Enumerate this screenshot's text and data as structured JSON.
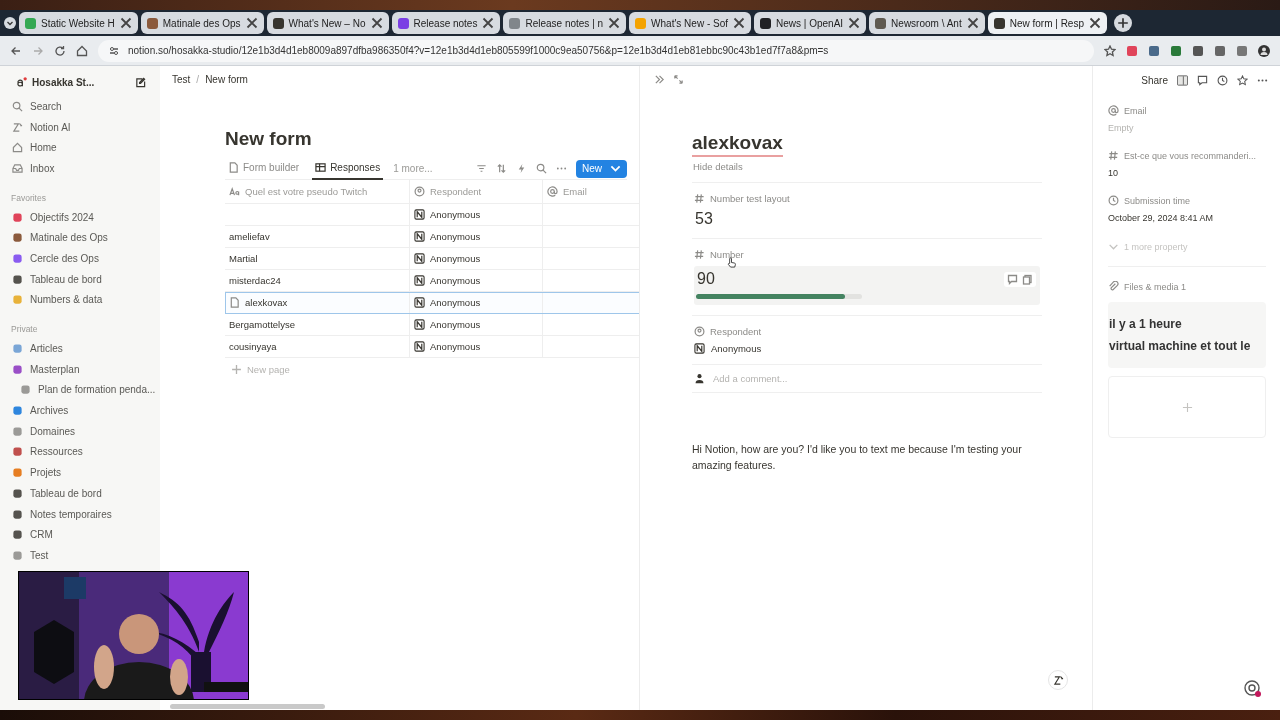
{
  "browser": {
    "tabs": [
      {
        "label": "Static Website H",
        "selected": false,
        "color": "#34a853"
      },
      {
        "label": "Matinale des Ops",
        "selected": false,
        "color": "#8b5a3c"
      },
      {
        "label": "What's New – No",
        "selected": false,
        "color": "#37352f"
      },
      {
        "label": "Release notes",
        "selected": false,
        "color": "#7b3fe4"
      },
      {
        "label": "Release notes | n",
        "selected": false,
        "color": "#80868b"
      },
      {
        "label": "What's New - Sof",
        "selected": false,
        "color": "#f4a300"
      },
      {
        "label": "News | OpenAI",
        "selected": false,
        "color": "#202124"
      },
      {
        "label": "Newsroom \\ Ant",
        "selected": false,
        "color": "#5f5a50"
      },
      {
        "label": "New form | Resp",
        "selected": true,
        "color": "#37352f"
      }
    ],
    "url": "notion.so/hosakka-studio/12e1b3d4d1eb8009a897dfba986350f4?v=12e1b3d4d1eb805599f1000c9ea50756&p=12e1b3d4d1eb81ebbc90c43b1ed7f7a8&pm=s"
  },
  "sidebar": {
    "workspace": "Hosakka St...",
    "nav": [
      {
        "label": "Search"
      },
      {
        "label": "Notion AI"
      },
      {
        "label": "Home"
      },
      {
        "label": "Inbox"
      }
    ],
    "sections": [
      {
        "title": "Favorites",
        "items": [
          {
            "label": "Objectifs 2024",
            "color": "#e0445a"
          },
          {
            "label": "Matinale des Ops",
            "color": "#8b5a3c"
          },
          {
            "label": "Cercle des Ops",
            "color": "#8a5cf0"
          },
          {
            "label": "Tableau de bord",
            "color": "#55534e"
          },
          {
            "label": "Numbers & data",
            "color": "#e8b23a"
          }
        ]
      },
      {
        "title": "Private",
        "items": [
          {
            "label": "Articles",
            "color": "#7aa6d6"
          },
          {
            "label": "Masterplan",
            "color": "#9a4fc7",
            "children": [
              {
                "label": "Plan de formation penda...",
                "color": "#9b9a97"
              }
            ]
          },
          {
            "label": "Archives",
            "color": "#2e86de"
          },
          {
            "label": "Domaines",
            "color": "#9b9a97"
          },
          {
            "label": "Ressources",
            "color": "#c0504d"
          },
          {
            "label": "Projets",
            "color": "#e67e22"
          },
          {
            "label": "Tableau de bord",
            "color": "#55534e"
          },
          {
            "label": "Notes temporaires",
            "color": "#55534e"
          },
          {
            "label": "CRM",
            "color": "#55534e"
          },
          {
            "label": "Test",
            "color": "#9b9a97"
          }
        ]
      }
    ]
  },
  "breadcrumb": [
    "Test",
    "New form"
  ],
  "breadcrumb_separator": "/",
  "page": {
    "title": "New form",
    "views": [
      {
        "label": "Form builder",
        "selected": false
      },
      {
        "label": "Responses",
        "selected": true
      }
    ],
    "more_views": "1 more...",
    "new_button": "New",
    "table": {
      "columns": [
        "Quel est votre pseudo Twitch",
        "Respondent",
        "Email"
      ],
      "rows": [
        {
          "name": "",
          "respondent": "Anonymous",
          "selected": false
        },
        {
          "name": "ameliefav",
          "respondent": "Anonymous",
          "selected": false
        },
        {
          "name": "Martial",
          "respondent": "Anonymous",
          "selected": false
        },
        {
          "name": "misterdac24",
          "respondent": "Anonymous",
          "selected": false
        },
        {
          "name": "alexkovax",
          "respondent": "Anonymous",
          "selected": true
        },
        {
          "name": "Bergamottelyse",
          "respondent": "Anonymous",
          "selected": false
        },
        {
          "name": "cousinyaya",
          "respondent": "Anonymous",
          "selected": false
        }
      ],
      "add_row": "New page"
    }
  },
  "peek": {
    "title": "alexkovax",
    "hide_details": "Hide details",
    "properties": [
      {
        "kind": "number",
        "label": "Number test layout",
        "value": "53"
      },
      {
        "kind": "bar",
        "label": "Number",
        "value": "90",
        "level": 0.9
      },
      {
        "kind": "person",
        "label": "Respondent",
        "value": "Anonymous"
      }
    ],
    "comment_placeholder": "Add a comment...",
    "body": "Hi Notion, how are you? I'd like you to text me because I'm testing your amazing features."
  },
  "details": {
    "share": "Share",
    "properties": [
      {
        "kind": "email",
        "label": "Email",
        "value": "Empty",
        "empty": true
      },
      {
        "kind": "number",
        "label": "Est-ce que vous recommanderi...",
        "value": "10",
        "empty": false
      },
      {
        "kind": "time",
        "label": "Submission time",
        "value": "October 29, 2024 8:41 AM",
        "empty": false
      }
    ],
    "more": "1 more property",
    "files_label": "Files & media 1",
    "file_preview": [
      "il y a 1 heure",
      "virtual machine et tout le"
    ]
  },
  "webcam": {
    "kind": "picture"
  }
}
